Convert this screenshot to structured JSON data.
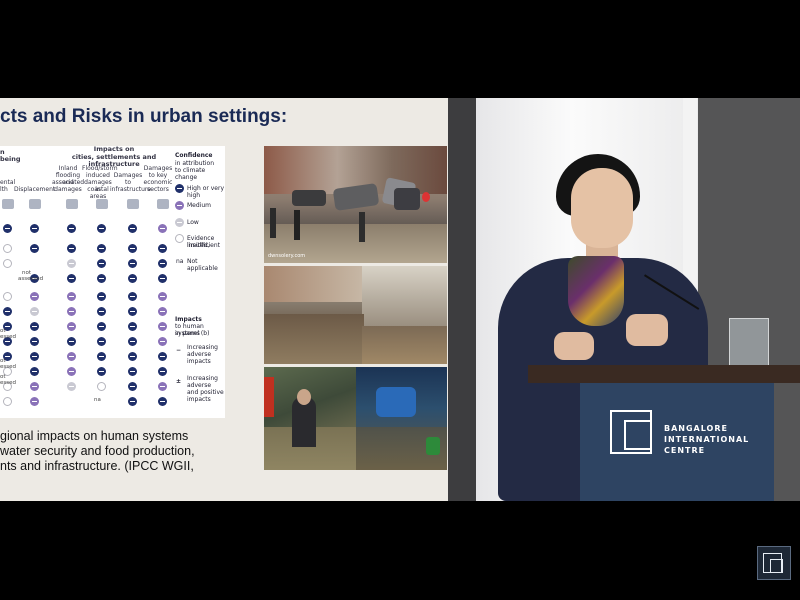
{
  "slide": {
    "title": "cts and Risks in urban settings:",
    "caption_lines": [
      "gional impacts on human systems",
      " water security and food production,",
      "nts and infrastructure.  (IPCC WGII,"
    ],
    "table": {
      "group_left_1": "n",
      "group_left_2": "being",
      "col_left_a": "ental",
      "col_left_b": "lth",
      "col_displacement": "Displacement",
      "group_header_1": "Impacts on",
      "group_header_2": "cities, settlements and infrastructure",
      "col_inland_1": "Inland",
      "col_inland_2": "flooding and",
      "col_inland_3": "associated",
      "col_inland_4": "damages",
      "col_flood_1": "Flood/storm",
      "col_flood_2": "induced",
      "col_flood_3": "damages in",
      "col_flood_4": "coastal areas",
      "col_infra_1": "Damages",
      "col_infra_2": "to",
      "col_infra_3": "infrastructure",
      "col_econ_1": "Damages",
      "col_econ_2": "to key",
      "col_econ_3": "economic",
      "col_econ_4": "sectors",
      "not_assessed_1": "not",
      "not_assessed_2": "assessed",
      "na": "na",
      "row_left_labels": [
        "ot",
        "essed",
        "ot",
        "essed",
        "ot",
        "essed"
      ]
    },
    "legend": {
      "confidence_1": "Confidence",
      "confidence_2": "in attribution",
      "confidence_3": "to climate change",
      "high": "High or very high",
      "medium": "Medium",
      "low": "Low",
      "evidence_1": "Evidence limited,",
      "evidence_2": "insufficient",
      "na": "na",
      "not_applicable": "Not applicable",
      "impacts_1": "Impacts",
      "impacts_2": "to human systems",
      "impacts_3": "in panel (b)",
      "minus": "−",
      "increasing_adverse_1": "Increasing",
      "increasing_adverse_2": "adverse",
      "increasing_adverse_3": "impacts",
      "plusminus": "±",
      "increasing_both_1": "Increasing",
      "increasing_both_2": "adverse",
      "increasing_both_3": "and positive",
      "increasing_both_4": "impacts"
    },
    "photo_credit": "dwnsolery.com"
  },
  "podium": {
    "line1": "BANGALORE",
    "line2": "INTERNATIONAL",
    "line3": "CENTRE"
  },
  "colors": {
    "title": "#1a2a55",
    "high": "#20306a",
    "medium": "#8a72b8",
    "low": "#c9c9d2",
    "podium": "#2e4462"
  }
}
